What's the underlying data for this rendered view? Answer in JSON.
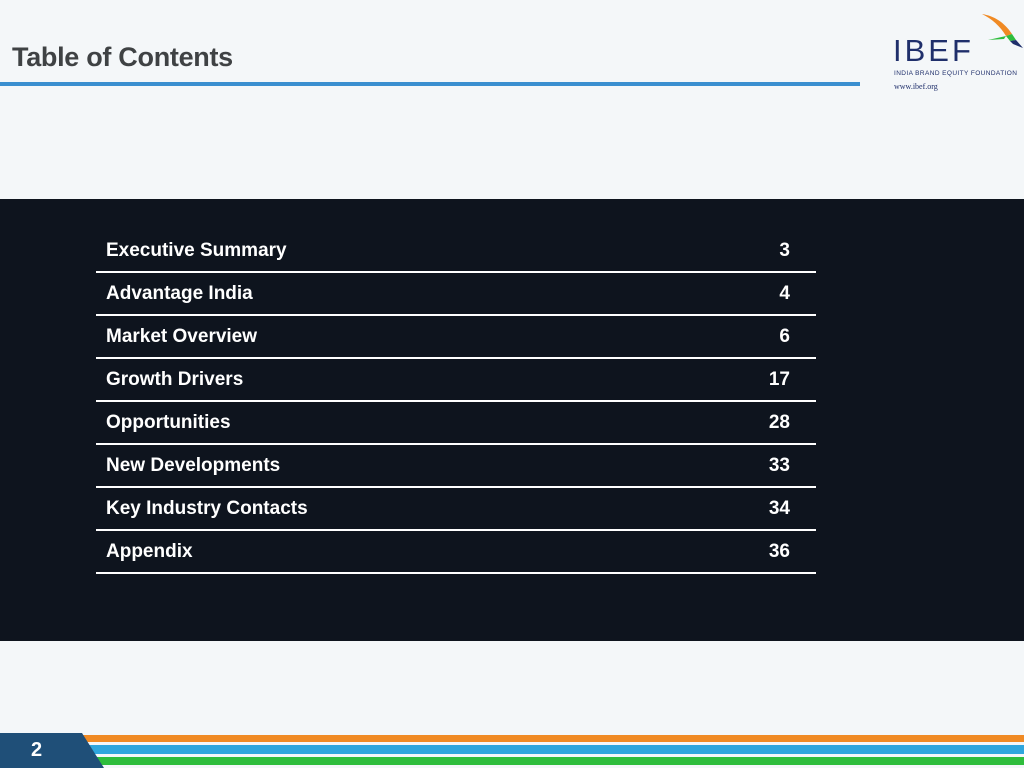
{
  "header": {
    "title": "Table of Contents"
  },
  "logo": {
    "word": "IBEF",
    "tagline": "INDIA BRAND EQUITY FOUNDATION",
    "url": "www.ibef.org",
    "icon": "bird-icon"
  },
  "toc": [
    {
      "label": "Executive Summary",
      "page": "3"
    },
    {
      "label": "Advantage India",
      "page": "4"
    },
    {
      "label": "Market Overview",
      "page": "6"
    },
    {
      "label": "Growth Drivers",
      "page": "17"
    },
    {
      "label": "Opportunities",
      "page": "28"
    },
    {
      "label": "New Developments",
      "page": "33"
    },
    {
      "label": "Key Industry Contacts",
      "page": "34"
    },
    {
      "label": "Appendix",
      "page": "36"
    }
  ],
  "footer": {
    "page_number": "2"
  },
  "colors": {
    "title_rule": "#3a8fd0",
    "panel": "#0e141e",
    "stripe_orange": "#f08a24",
    "stripe_blue": "#2fa6dd",
    "stripe_green": "#2ebd3c",
    "page_box": "#1f4f78"
  }
}
